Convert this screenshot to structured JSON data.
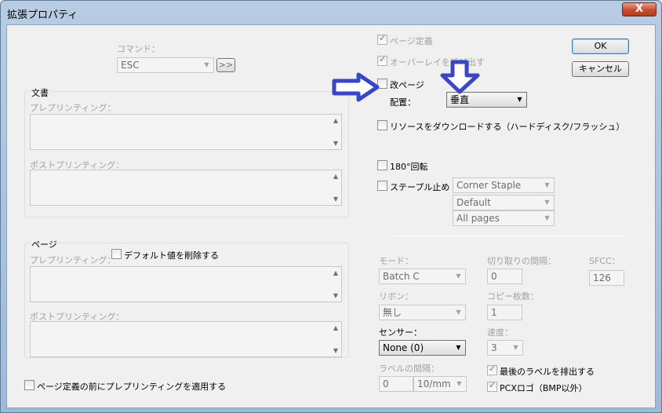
{
  "window": {
    "title": "拡張プロパティ",
    "close_label": "X"
  },
  "buttons": {
    "ok": "OK",
    "cancel": "キャンセル"
  },
  "command": {
    "label": "コマンド：",
    "value": "ESC",
    "more": ">>"
  },
  "document_group": {
    "title": "文書",
    "preprint_label": "プレプリンティング：",
    "postprint_label": "ポストプリンティング："
  },
  "page_group": {
    "title": "ページ",
    "preprint_label": "プレプリンティング：",
    "postprint_label": "ポストプリンティング：",
    "delete_default_label": "デフォルト値を削除する"
  },
  "apply_preprint_label": "ページ定義の前にプレプリンティングを適用する",
  "page_definition_label": "ページ定義",
  "call_overlay_label": "オーバーレイを呼び出す",
  "page_break": {
    "label": "改ページ",
    "placement_label": "配置：",
    "placement_value": "垂直"
  },
  "download_resources_label": "リソースをダウンロードする（ハードディスク/フラッシュ）",
  "rotate_label": "180°回転",
  "staple": {
    "label": "ステープル止め",
    "option1": "Corner Staple",
    "option2": "Default",
    "option3": "All pages"
  },
  "mode": {
    "label": "モード：",
    "value": "Batch C"
  },
  "ribbon": {
    "label": "リボン：",
    "value": "無し"
  },
  "sensor": {
    "label": "センサー：",
    "value": "None (0)"
  },
  "label_gap": {
    "label": "ラベルの間隔：",
    "value": "0",
    "unit": "10/mm"
  },
  "cut_interval": {
    "label": "切り取りの間隔：",
    "value": "0"
  },
  "copies": {
    "label": "コピー枚数：",
    "value": "1"
  },
  "speed": {
    "label": "速度：",
    "value": "3"
  },
  "sfcc": {
    "label": "SFCC：",
    "value": "126"
  },
  "eject_last_label": "最後のラベルを排出する",
  "pcx_logo_label": "PCXロゴ（BMP以外）",
  "colors": {
    "arrow": "#3b46c4",
    "title_bar": "#b8cde4"
  }
}
